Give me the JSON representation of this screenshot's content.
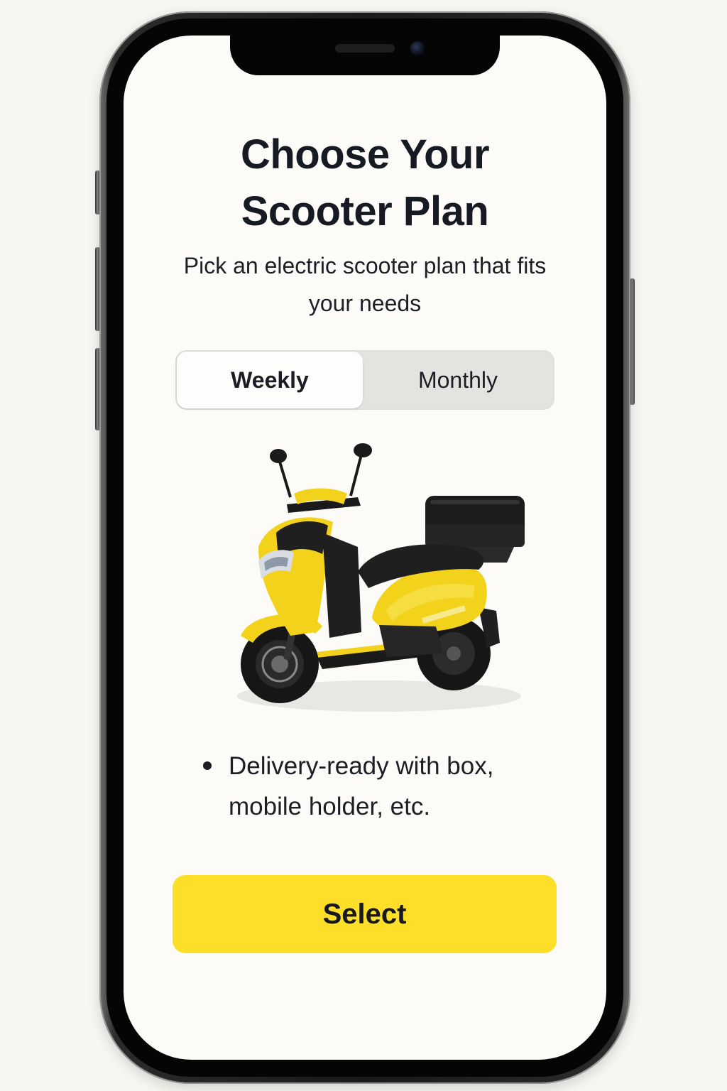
{
  "header": {
    "title_line1": "Choose Your",
    "title_line2": "Scooter Plan",
    "subtitle": "Pick an electric scooter plan that fits your needs"
  },
  "plan_toggle": {
    "options": [
      {
        "label": "Weekly",
        "selected": true
      },
      {
        "label": "Monthly",
        "selected": false
      }
    ]
  },
  "product": {
    "image": "yellow-electric-scooter-with-top-box",
    "colors": {
      "body": "#f2d21b",
      "seat": "#1e1e1e",
      "box": "#1a1a1a"
    }
  },
  "features": [
    {
      "text": "Delivery-ready with box, mobile holder, etc."
    }
  ],
  "cta": {
    "label": "Select",
    "color": "#fddf2a"
  }
}
